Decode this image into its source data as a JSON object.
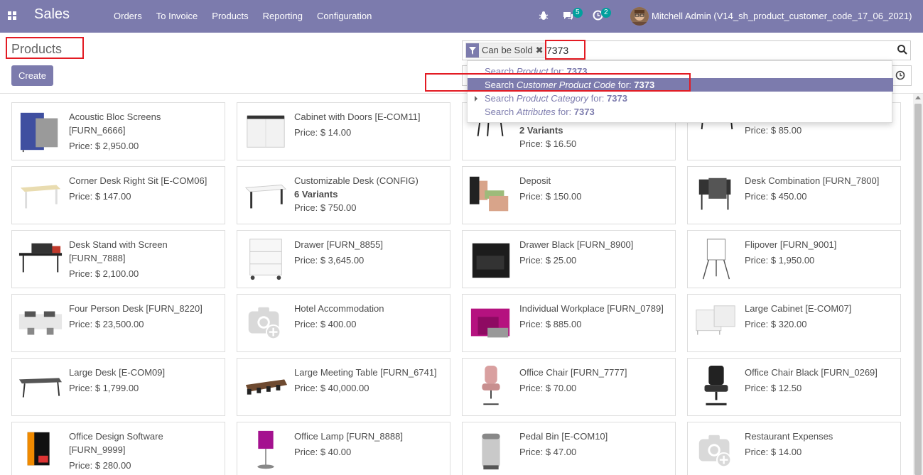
{
  "navbar": {
    "app_title": "Sales",
    "menu": [
      "Orders",
      "To Invoice",
      "Products",
      "Reporting",
      "Configuration"
    ],
    "message_count": "5",
    "activity_count": "2",
    "user": "Mitchell Admin (V14_sh_product_customer_code_17_06_2021)"
  },
  "control_panel": {
    "breadcrumb": "Products",
    "create_label": "Create"
  },
  "search": {
    "facet_label": "Can be Sold",
    "facet_remove": "✖",
    "query": "7373",
    "options": [
      {
        "prefix": "Search ",
        "field": "Product",
        "suffix": " for: ",
        "value": "7373"
      },
      {
        "prefix": "Search ",
        "field": "Customer Product Code",
        "suffix": " for: ",
        "value": "7373"
      },
      {
        "prefix": "Search ",
        "field": "Product Category",
        "suffix": " for: ",
        "value": "7373"
      },
      {
        "prefix": "Search ",
        "field": "Attributes",
        "suffix": " for: ",
        "value": "7373"
      }
    ]
  },
  "colors": {
    "brand": "#7c7bad",
    "badge": "#00a09d",
    "annotation": "#e31b23"
  },
  "products": [
    {
      "name": "Acoustic Bloc Screens [FURN_6666]",
      "variants": "",
      "price": "Price: $ 2,950.00",
      "image": "acoustic-screen"
    },
    {
      "name": "Cabinet with Doors [E-COM11]",
      "variants": "",
      "price": "Price: $ 14.00",
      "image": "cabinet-white"
    },
    {
      "name": "",
      "variants": "2 Variants",
      "price": "Price: $ 16.50",
      "image": "stool-black"
    },
    {
      "name": "",
      "variants": "",
      "price": "Price: $ 85.00",
      "image": "desk-wood"
    },
    {
      "name": "Corner Desk Right Sit [E-COM06]",
      "variants": "",
      "price": "Price: $ 147.00",
      "image": "desk-light"
    },
    {
      "name": "Customizable Desk (CONFIG)",
      "variants": "6 Variants",
      "price": "Price: $ 750.00",
      "image": "desk-white"
    },
    {
      "name": "Deposit",
      "variants": "",
      "price": "Price: $ 150.00",
      "image": "money-hands"
    },
    {
      "name": "Desk Combination [FURN_7800]",
      "variants": "",
      "price": "Price: $ 450.00",
      "image": "desk-combo"
    },
    {
      "name": "Desk Stand with Screen [FURN_7888]",
      "variants": "",
      "price": "Price: $ 2,100.00",
      "image": "desk-stand"
    },
    {
      "name": "Drawer [FURN_8855]",
      "variants": "",
      "price": "Price: $ 3,645.00",
      "image": "drawer-white"
    },
    {
      "name": "Drawer Black [FURN_8900]",
      "variants": "",
      "price": "Price: $ 25.00",
      "image": "drawer-black"
    },
    {
      "name": "Flipover [FURN_9001]",
      "variants": "",
      "price": "Price: $ 1,950.00",
      "image": "flipover"
    },
    {
      "name": "Four Person Desk [FURN_8220]",
      "variants": "",
      "price": "Price: $ 23,500.00",
      "image": "four-desk"
    },
    {
      "name": "Hotel Accommodation",
      "variants": "",
      "price": "Price: $ 400.00",
      "image": "placeholder-camera"
    },
    {
      "name": "Individual Workplace [FURN_0789]",
      "variants": "",
      "price": "Price: $ 885.00",
      "image": "workplace-magenta"
    },
    {
      "name": "Large Cabinet [E-COM07]",
      "variants": "",
      "price": "Price: $ 320.00",
      "image": "large-cabinet"
    },
    {
      "name": "Large Desk [E-COM09]",
      "variants": "",
      "price": "Price: $ 1,799.00",
      "image": "large-desk"
    },
    {
      "name": "Large Meeting Table [FURN_6741]",
      "variants": "",
      "price": "Price: $ 40,000.00",
      "image": "meeting-table"
    },
    {
      "name": "Office Chair [FURN_7777]",
      "variants": "",
      "price": "Price: $ 70.00",
      "image": "chair-pink"
    },
    {
      "name": "Office Chair Black [FURN_0269]",
      "variants": "",
      "price": "Price: $ 12.50",
      "image": "chair-black"
    },
    {
      "name": "Office Design Software [FURN_9999]",
      "variants": "",
      "price": "Price: $ 280.00",
      "image": "software-box"
    },
    {
      "name": "Office Lamp [FURN_8888]",
      "variants": "",
      "price": "Price: $ 40.00",
      "image": "lamp-purple"
    },
    {
      "name": "Pedal Bin [E-COM10]",
      "variants": "",
      "price": "Price: $ 47.00",
      "image": "pedal-bin"
    },
    {
      "name": "Restaurant Expenses",
      "variants": "",
      "price": "Price: $ 14.00",
      "image": "placeholder-camera"
    }
  ]
}
